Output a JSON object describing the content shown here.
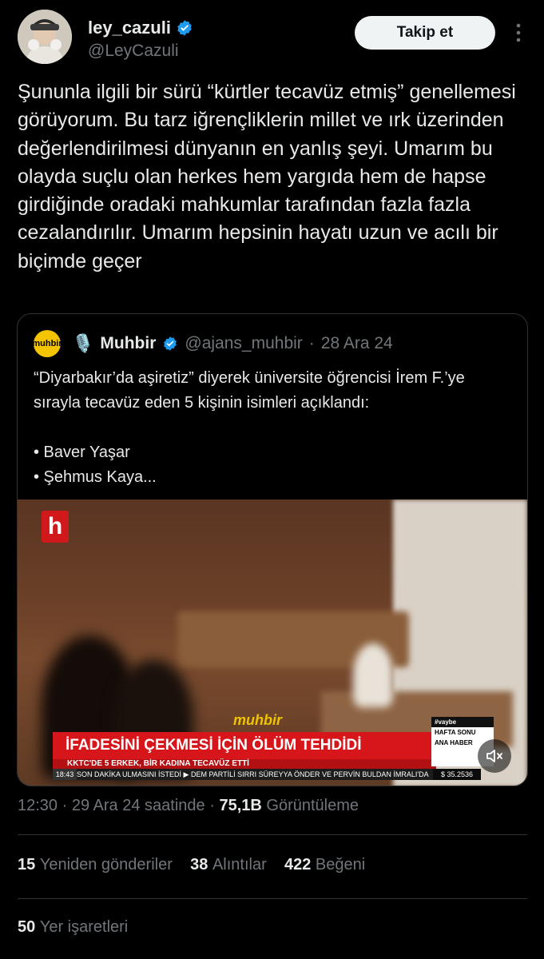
{
  "author": {
    "display_name": "ley_cazuli",
    "handle": "@LeyCazuli",
    "follow_label": "Takip et"
  },
  "tweet": {
    "text": "Şununla ilgili bir sürü “kürtler tecavüz etmiş” genellemesi görüyorum. Bu tarz iğrençliklerin millet ve ırk üzerinden değerlendirilmesi dünyanın en yanlış şeyi. Umarım bu olayda suçlu olan herkes hem yargıda hem de hapse girdiğinde oradaki mahkumlar tarafından fazla fazla cezalandırılır. Umarım hepsinin hayatı uzun ve acılı bir biçimde geçer"
  },
  "quote": {
    "logo_text": "muhbir",
    "emoji": "🎙️",
    "name": "Muhbir",
    "handle": "@ajans_muhbir",
    "separator": "·",
    "date": "28 Ara 24",
    "text": "“Diyarbakır’da aşiretiz” diyerek üniversite öğrencisi İrem F.’ye sırayla tecavüz eden 5 kişinin isimleri açıklandı:\n\n• Baver Yaşar\n• Şehmus Kaya...",
    "video": {
      "channel_logo": "h",
      "brand": "muhbir",
      "headline": "İFADESİNİ ÇEKMESİ İÇİN ÖLÜM TEHDİDİ",
      "subheadline": "KKTC'DE 5 ERKEK, BİR KADINA TECAVÜZ ETTİ",
      "ticker_time": "18:43",
      "ticker_text": "SON DAKİKA  ULMASINI İSTEDİ  ▶ DEM PARTİLİ SIRRI SÜREYYA ÖNDER VE PERVİN BULDAN İMRALI'DA",
      "ticker_price": "$ 35.2536",
      "side_tag": "#vaybe",
      "side_line1": "HAFTA SONU",
      "side_line2": "ANA HABER"
    }
  },
  "meta": {
    "time": "12:30",
    "date": "29 Ara 24 saatinde",
    "separator": "·",
    "views_count": "75,1B",
    "views_label": "Görüntüleme"
  },
  "stats": {
    "retweets_count": "15",
    "retweets_label": "Yeniden gönderiler",
    "quotes_count": "38",
    "quotes_label": "Alıntılar",
    "likes_count": "422",
    "likes_label": "Beğeni",
    "bookmarks_count": "50",
    "bookmarks_label": "Yer işaretleri"
  },
  "colors": {
    "background": "#000000",
    "text": "#e7e9ea",
    "secondary": "#71767b",
    "verified": "#1d9bf0"
  }
}
